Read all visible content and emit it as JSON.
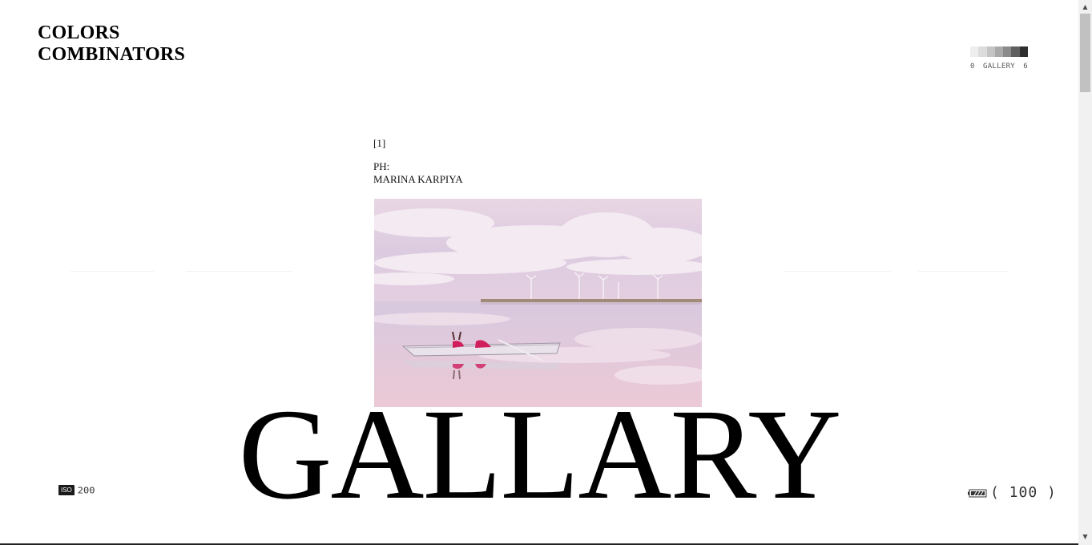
{
  "brand": {
    "line1": "COLORS",
    "line2": "COMBINATORS"
  },
  "gallery_meter": {
    "min_label": "0",
    "label": "GALLERY",
    "max_label": "6",
    "swatch_colors": [
      "#eeeeee",
      "#dcdcdc",
      "#c4c4c4",
      "#a9a9a9",
      "#8a8a8a",
      "#5f5f5f",
      "#2e2e2e"
    ]
  },
  "photo": {
    "index": "[1]",
    "credit_prefix": "PH:",
    "credit_name": "MARINA KARPIYA"
  },
  "title": "GALLARY",
  "camera": {
    "iso_label": "ISO",
    "iso_value": "200",
    "battery_value": "( 100 )"
  },
  "colors": {
    "text": "#000000",
    "photo_sky": "#e7d3e1",
    "boat_accent": "#d01d5c"
  }
}
